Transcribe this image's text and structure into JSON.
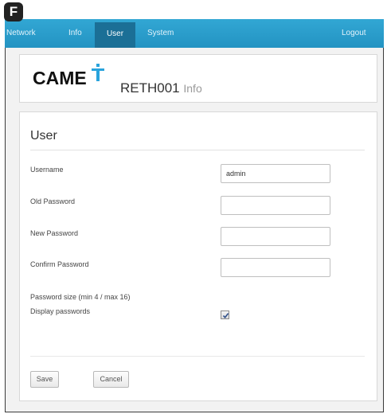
{
  "step_marker": "F",
  "navbar": {
    "items": [
      {
        "label": "Network"
      },
      {
        "label": "Info"
      },
      {
        "label": "User"
      },
      {
        "label": "System"
      }
    ],
    "logout_label": "Logout"
  },
  "header": {
    "brand": "CAME",
    "device_model": "RETH001",
    "device_suffix": "Info"
  },
  "form": {
    "title": "User",
    "username_label": "Username",
    "username_value": "admin",
    "old_password_label": "Old Password",
    "new_password_label": "New Password",
    "confirm_password_label": "Confirm Password",
    "password_hint": "Password size (min 4 / max 16)",
    "display_passwords_label": "Display passwords",
    "display_passwords_checked": true,
    "save_label": "Save",
    "cancel_label": "Cancel"
  },
  "colors": {
    "navbar": "#2a9cca",
    "nav_active": "#1b6f96",
    "logo_accent": "#29a3dc"
  }
}
